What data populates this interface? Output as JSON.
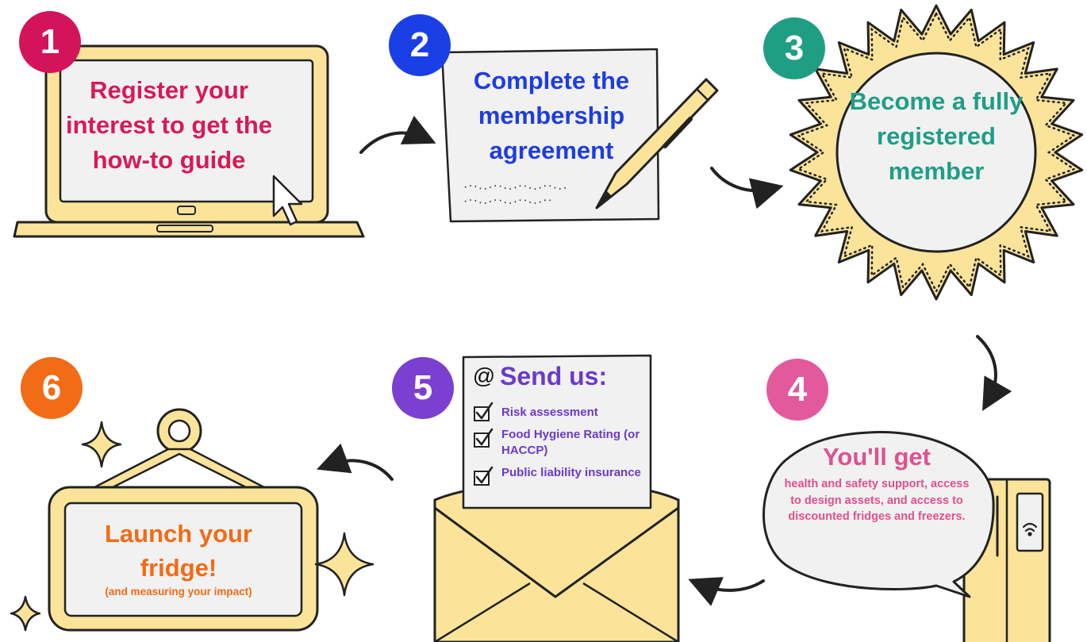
{
  "colors": {
    "yellow": "#fbe49a",
    "outline": "#222222",
    "screen": "#f1f1f1",
    "step1": "#d4145a",
    "step2": "#1b3fe6",
    "step3": "#1f9e84",
    "step4": "#e35a9c",
    "step5": "#7b3fd1",
    "step6": "#f26b16"
  },
  "steps": [
    {
      "number": "1",
      "text": "Register your interest to get the how-to guide",
      "icon": "laptop-icon"
    },
    {
      "number": "2",
      "text": "Complete the membership agreement",
      "icon": "pen-and-paper-icon"
    },
    {
      "number": "3",
      "text": "Become a fully registered member",
      "icon": "starburst-badge-icon"
    },
    {
      "number": "4",
      "heading": "You'll get",
      "text": "health and safety support, access to design assets, and access to discounted fridges and freezers.",
      "icon": "speech-bubble-fridge-icon"
    },
    {
      "number": "5",
      "at_symbol": "@",
      "heading": "Send us:",
      "checklist": [
        "Risk assessment",
        "Food Hygiene Rating (or HACCP)",
        "Public liability insurance"
      ],
      "icon": "envelope-icon"
    },
    {
      "number": "6",
      "heading": "Launch your fridge!",
      "text": "(and measuring your impact)",
      "icon": "hanging-sign-icon"
    }
  ]
}
